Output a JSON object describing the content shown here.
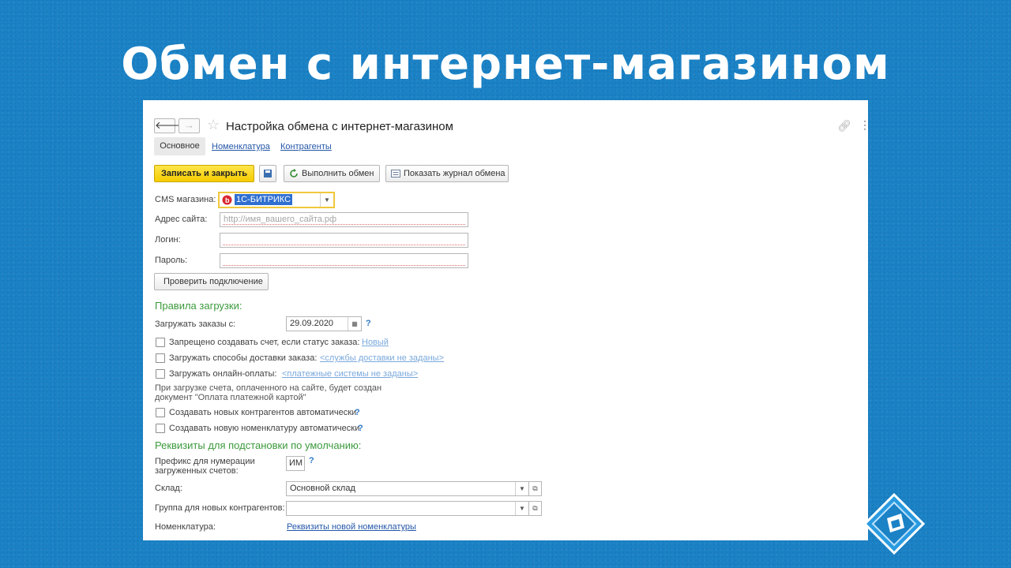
{
  "slide": {
    "title": "Обмен с интернет-магазином"
  },
  "window": {
    "title": "Настройка обмена с интернет-магазином",
    "nav": {
      "back": "🡐",
      "forward": "→"
    },
    "tabs": [
      {
        "label": "Основное",
        "active": true
      },
      {
        "label": "Номенклатура",
        "active": false
      },
      {
        "label": "Контрагенты",
        "active": false
      }
    ]
  },
  "toolbar": {
    "save_close": "Записать и закрыть",
    "run_exchange": "Выполнить обмен",
    "show_log": "Показать журнал обмена"
  },
  "connection": {
    "cms_label": "CMS магазина:",
    "cms_value": "1С-БИТРИКС",
    "site_label": "Адрес сайта:",
    "site_placeholder": "http://имя_вашего_сайта.рф",
    "login_label": "Логин:",
    "login_value": "",
    "password_label": "Пароль:",
    "password_value": "",
    "check_button": "Проверить подключение"
  },
  "load_rules": {
    "title": "Правила загрузки:",
    "orders_from_label": "Загружать заказы с:",
    "orders_from_value": "29.09.2020",
    "help": "?",
    "forbid_invoice": {
      "label": "Запрещено создавать счет, если статус заказа:",
      "link": "Новый",
      "checked": false
    },
    "delivery_methods": {
      "label": "Загружать способы доставки заказа:",
      "link": "<службы доставки не заданы>",
      "checked": false
    },
    "online_payments": {
      "label": "Загружать онлайн-оплаты:",
      "link": "<платежные системы не заданы>",
      "checked": false
    },
    "payment_note_line1": "При загрузке счета, оплаченного на сайте, будет создан",
    "payment_note_line2": "документ \"Оплата платежной картой\"",
    "auto_contractors": {
      "label": "Создавать новых контрагентов автоматически",
      "checked": false
    },
    "auto_items": {
      "label": "Создавать новую номенклатуру автоматически",
      "checked": false
    }
  },
  "defaults": {
    "title": "Реквизиты для подстановки по умолчанию:",
    "prefix_label_line1": "Префикс для нумерации",
    "prefix_label_line2": "загруженных счетов:",
    "prefix_value": "ИМ",
    "warehouse_label": "Склад:",
    "warehouse_value": "Основной склад",
    "group_label": "Группа для новых контрагентов:",
    "group_value": "",
    "items_label": "Номенклатура:",
    "items_link": "Реквизиты новой номенклатуры"
  },
  "colors": {
    "background": "#1b82c6",
    "primary_button": "#f5cc00",
    "section_title": "#3c9a3c",
    "link": "#2457a8",
    "help": "#2e78c7"
  },
  "icons": [
    "back-arrow-icon",
    "forward-arrow-icon",
    "star-icon",
    "link-icon",
    "more-icon",
    "save-icon",
    "refresh-icon",
    "journal-icon",
    "bitrix-icon",
    "dropdown-icon",
    "calendar-icon",
    "open-icon",
    "brand-logo-icon"
  ]
}
